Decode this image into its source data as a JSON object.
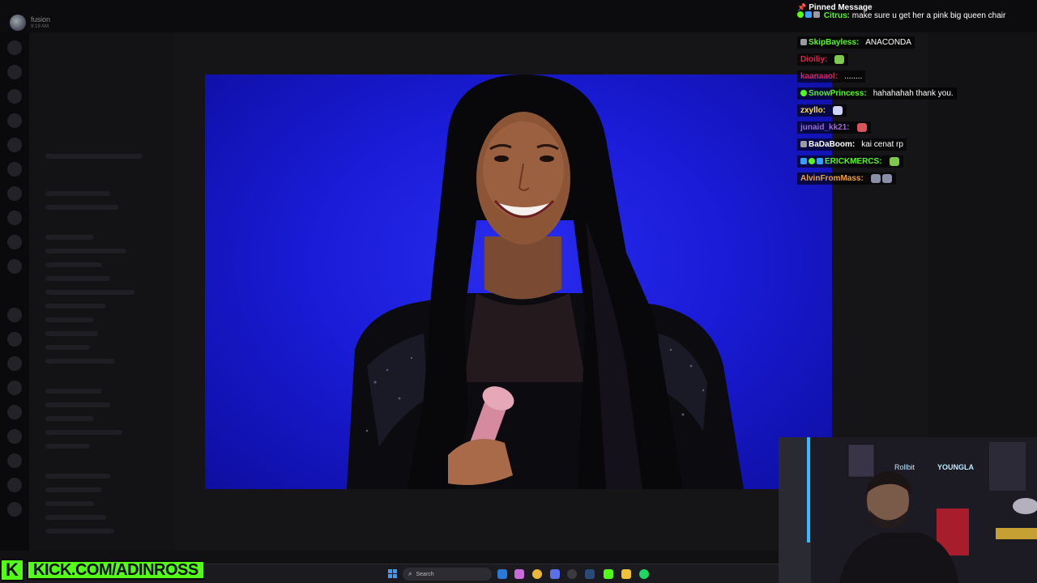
{
  "app": {
    "name": "fusion",
    "time": "9:19 AM"
  },
  "chat": {
    "pinned": {
      "header": "Pinned Message",
      "user": "Citrus:",
      "message": "make sure u get her a pink big queen chair",
      "user_color": "#53fc18"
    },
    "messages": [
      {
        "user": "SkipBayless:",
        "text": "ANACONDA",
        "color": "#53fc18",
        "badges": [
          "gray"
        ],
        "emotes": []
      },
      {
        "user": "Dioiliy:",
        "text": "",
        "color": "#e0244c",
        "badges": [],
        "emotes": [
          "#7ec850"
        ]
      },
      {
        "user": "kaanaaol:",
        "text": "........",
        "color": "#e0244c",
        "badges": [],
        "emotes": []
      },
      {
        "user": "SnowPrincess:",
        "text": "hahahahah thank you.",
        "color": "#53fc18",
        "badges": [
          "green"
        ],
        "emotes": []
      },
      {
        "user": "zxyllo:",
        "text": "",
        "color": "#ffe14d",
        "badges": [],
        "emotes": [
          "#cfd3ff"
        ]
      },
      {
        "user": "junaid_kk21:",
        "text": "",
        "color": "#9b6bd6",
        "badges": [],
        "emotes": [
          "#d6545a"
        ]
      },
      {
        "user": "BaDaBoom:",
        "text": "kai cenat rp",
        "color": "#ffffff",
        "badges": [
          "gray"
        ],
        "emotes": []
      },
      {
        "user": "ERICKMERCS:",
        "text": "",
        "color": "#53fc18",
        "badges": [
          "blue",
          "green",
          "blue"
        ],
        "emotes": [
          "#7ec850"
        ]
      },
      {
        "user": "AlvinFromMass:",
        "text": "",
        "color": "#f0a23a",
        "badges": [],
        "emotes": [
          "#8a8fa8",
          "#8a8fa8"
        ]
      }
    ]
  },
  "taskbar": {
    "search_label": "Search"
  },
  "brand": {
    "logo": "K",
    "url": "KICK.COM/ADINROSS",
    "color": "#53fc18"
  },
  "webcam": {
    "sign_left": "Rollbit",
    "sign_right": "YOUNGLA"
  }
}
